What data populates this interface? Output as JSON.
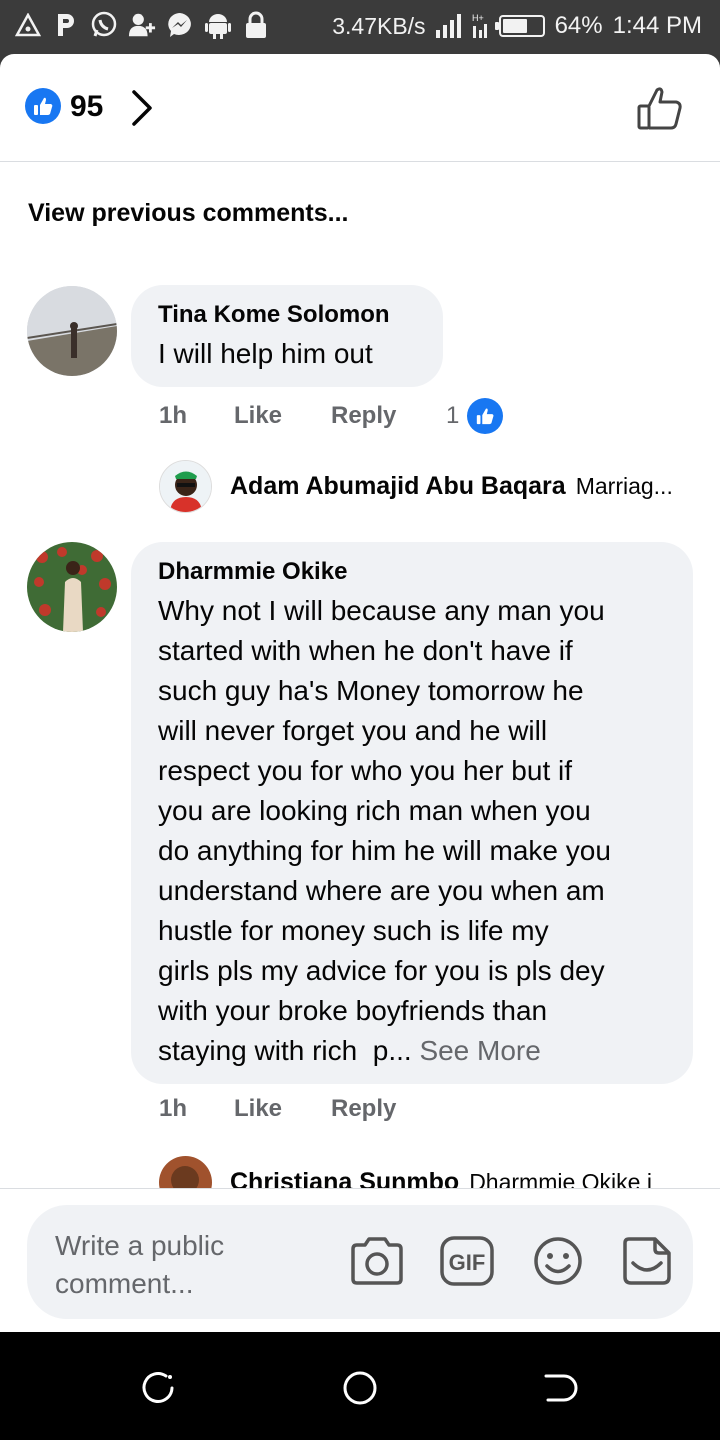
{
  "status_bar": {
    "net_speed": "3.47KB/s",
    "battery": "64%",
    "battery_level": 0.64,
    "time": "1:44 PM",
    "notification_icons": [
      "triangle-icon",
      "p-icon",
      "whatsapp-icon",
      "add-contact-icon",
      "messenger-icon",
      "android-icon",
      "lock-icon"
    ]
  },
  "reactions": {
    "count": "95"
  },
  "view_previous": "View previous comments...",
  "comments": [
    {
      "author": "Tina Kome Solomon",
      "text": "I will help him out",
      "time": "1h",
      "like": "Like",
      "reply": "Reply",
      "like_count": "1"
    },
    {
      "author": "Dharmmie Okike",
      "lines": [
        "Why not I will because any man you",
        "started with when he don't have if",
        "such guy ha's Money tomorrow he",
        "will never forget you and he will",
        "respect you for who you her but if",
        "you are looking rich man when you",
        "do anything for him he will make you",
        "understand where are you when am",
        "hustle for money  such is life my",
        "girls pls my advice for you is pls dey",
        "with your broke boyfriends than",
        "staying with rich  p... "
      ],
      "see_more": "See More",
      "time": "1h",
      "like": "Like",
      "reply": "Reply"
    }
  ],
  "replies": [
    {
      "author": "Adam Abumajid Abu Baqara",
      "snippet": "Marriag..."
    },
    {
      "author": "Christiana Sunmbo",
      "snippet": "Dharmmie Okike i"
    }
  ],
  "composer": {
    "placeholder_line1": "Write a public",
    "placeholder_line2": "comment...",
    "icons": [
      "camera-icon",
      "gif-icon",
      "emoji-icon",
      "sticker-icon"
    ]
  },
  "colors": {
    "accent": "#1877f2",
    "bubble": "#f0f2f5",
    "meta": "#65676b"
  }
}
